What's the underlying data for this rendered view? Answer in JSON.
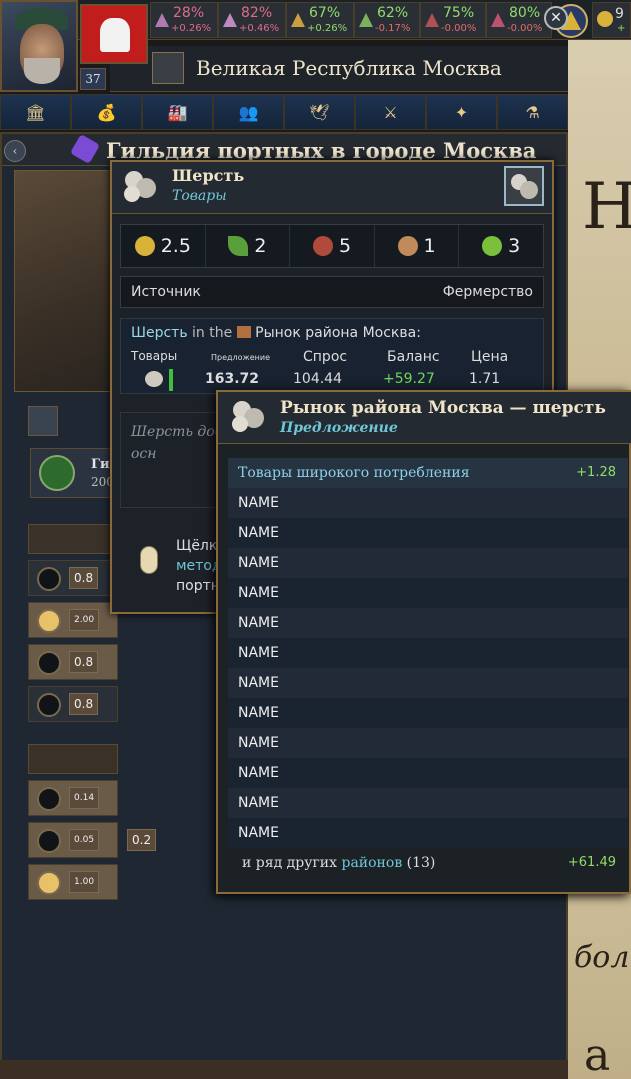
{
  "top": {
    "level": "37",
    "stats": [
      {
        "value": "28%",
        "delta": "+0.26%",
        "icon": "stability-icon",
        "tone": "pink"
      },
      {
        "value": "82%",
        "delta": "+0.46%",
        "icon": "legitimacy-icon",
        "tone": "pink"
      },
      {
        "value": "67%",
        "delta": "+0.26%",
        "icon": "literacy-icon",
        "tone": "green"
      },
      {
        "value": "62%",
        "delta": "-0.17%",
        "icon": "prosperity-icon",
        "tone": "green-neg"
      },
      {
        "value": "75%",
        "delta": "-0.00%",
        "icon": "production-icon",
        "tone": "green-neg"
      },
      {
        "value": "80%",
        "delta": "-0.00%",
        "icon": "happiness-icon",
        "tone": "green-neg"
      }
    ],
    "gold_partial": "9",
    "gold_delta_partial": "+"
  },
  "country": {
    "name": "Великая Республика Москва"
  },
  "tabs": [
    "economy-tab",
    "trade-tab",
    "buildings-tab",
    "society-tab",
    "religion-tab",
    "military-tab",
    "diplomacy-tab",
    "alchemy-tab"
  ],
  "panel": {
    "title": "Гильдия портных в городе Москва",
    "guild_label": "Гил",
    "guild_sub": "200",
    "rows": [
      {
        "amount": "0.8",
        "on": false
      },
      {
        "amount": "2.00",
        "on": true
      },
      {
        "amount": "0.8",
        "on": false
      },
      {
        "amount": "0.8",
        "on": false
      },
      {
        "amount": "0.14",
        "on": false
      },
      {
        "amount": "0.05",
        "amount2": "0.2",
        "on": false
      },
      {
        "amount": "1.00",
        "on": true
      }
    ]
  },
  "wool": {
    "title": "Шерсть",
    "subtitle": "Товары",
    "costs": [
      {
        "value": "2.5",
        "icon": "gold-coin-icon",
        "color": "#d9b23a"
      },
      {
        "value": "2",
        "icon": "leaf-icon",
        "color": "#5aa03a"
      },
      {
        "value": "5",
        "icon": "meat-icon",
        "color": "#b04a3a"
      },
      {
        "value": "1",
        "icon": "bread-icon",
        "color": "#c08a5a"
      },
      {
        "value": "3",
        "icon": "apple-icon",
        "color": "#7ac03a"
      }
    ],
    "source_label": "Источник",
    "source_value": "Фермерство",
    "market_prefix": "Шерсть",
    "market_in": "in the",
    "market_name": "Рынок района Москва:",
    "cols": [
      "Товары",
      "Предложение",
      "Спрос",
      "Баланс",
      "Цена"
    ],
    "supply": "163.72",
    "demand": "104.44",
    "balance": "+59.27",
    "price": "1.71",
    "description": "Шерсть добы на участках хозяйства. Д одежду в осн",
    "hint_line1": "Щёлкн",
    "hint_line2": "метод",
    "hint_line3": "портн"
  },
  "market_tt": {
    "title": "Рынок района Москва — шерсть",
    "subtitle": "Предложение",
    "first": {
      "label": "Товары широкого потребления",
      "value": "+1.28"
    },
    "names": [
      "NAME",
      "NAME",
      "NAME",
      "NAME",
      "NAME",
      "NAME",
      "NAME",
      "NAME",
      "NAME",
      "NAME",
      "NAME",
      "NAME"
    ],
    "footer_pre": "и ряд других",
    "footer_link": "районов",
    "footer_count": "(13)",
    "footer_value": "+61.49"
  },
  "map": {
    "letter1": "H",
    "word": "бол",
    "letter2": "a"
  }
}
